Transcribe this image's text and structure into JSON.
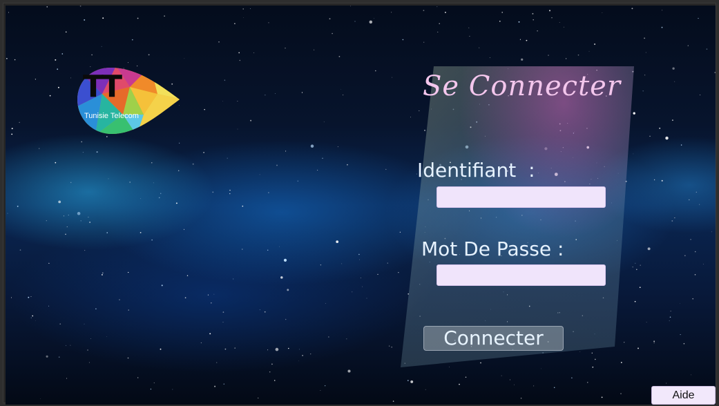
{
  "logo": {
    "title": "TT",
    "subtitle": "Tunisie Telecom"
  },
  "login": {
    "title": "Se Connecter",
    "username_label": "Identifiant  :",
    "username_value": "",
    "password_label": "Mot De Passe :",
    "password_value": "",
    "submit_label": "Connecter"
  },
  "help_button_label": "Aide",
  "colors": {
    "title": "#f3c6ec",
    "input_background": "#f0e4fb",
    "label": "#e6f2ff",
    "background": "#07142d"
  }
}
